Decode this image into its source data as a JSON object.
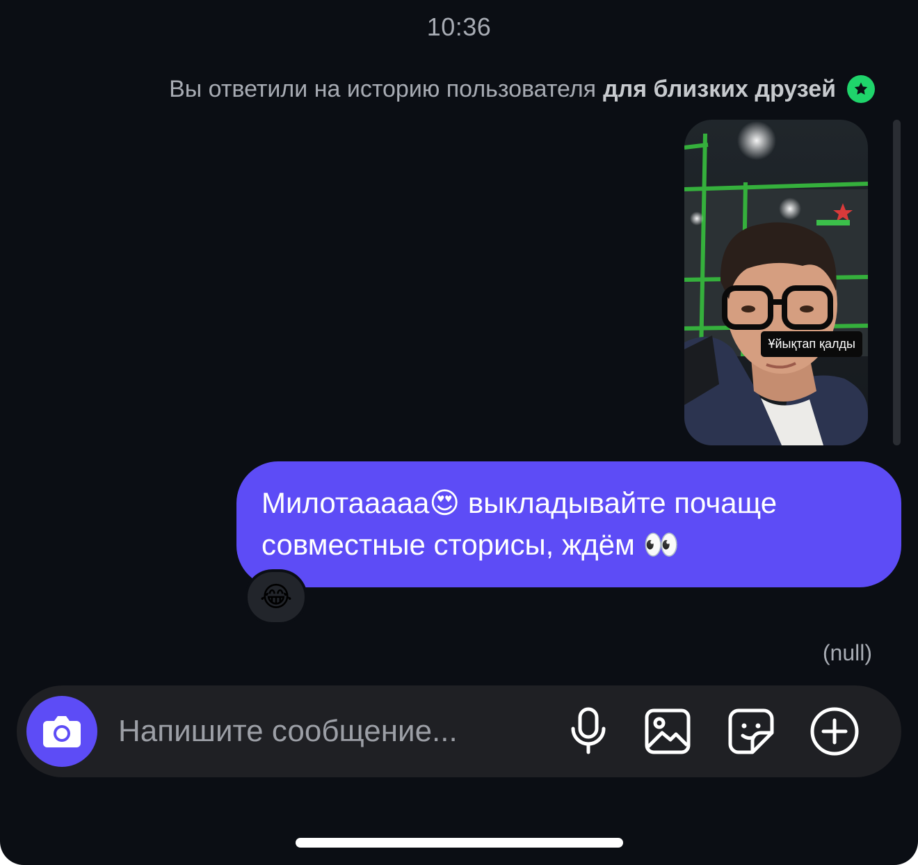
{
  "status": {
    "time": "10:36"
  },
  "thread": {
    "story_reply_note_prefix": "Вы ответили на историю пользователя ",
    "story_reply_note_bold": "для близких друзей",
    "story_caption": "Ұйықтап қалды",
    "message_text": "Милотааааа😍  выкладывайте почаще совместные сторисы, ждём 👀",
    "reaction_emoji": "😂",
    "seen_status": "(null)"
  },
  "composer": {
    "placeholder": "Напишите сообщение..."
  },
  "colors": {
    "background": "#0b0e14",
    "bubble": "#5d4cf6",
    "close_friends_badge": "#1fd46b",
    "composer_bg": "#1f2024"
  },
  "icons": {
    "camera": "camera-icon",
    "microphone": "microphone-icon",
    "gallery": "gallery-icon",
    "sticker": "sticker-icon",
    "more": "plus-circle-icon",
    "close_friends": "star-badge-icon"
  }
}
